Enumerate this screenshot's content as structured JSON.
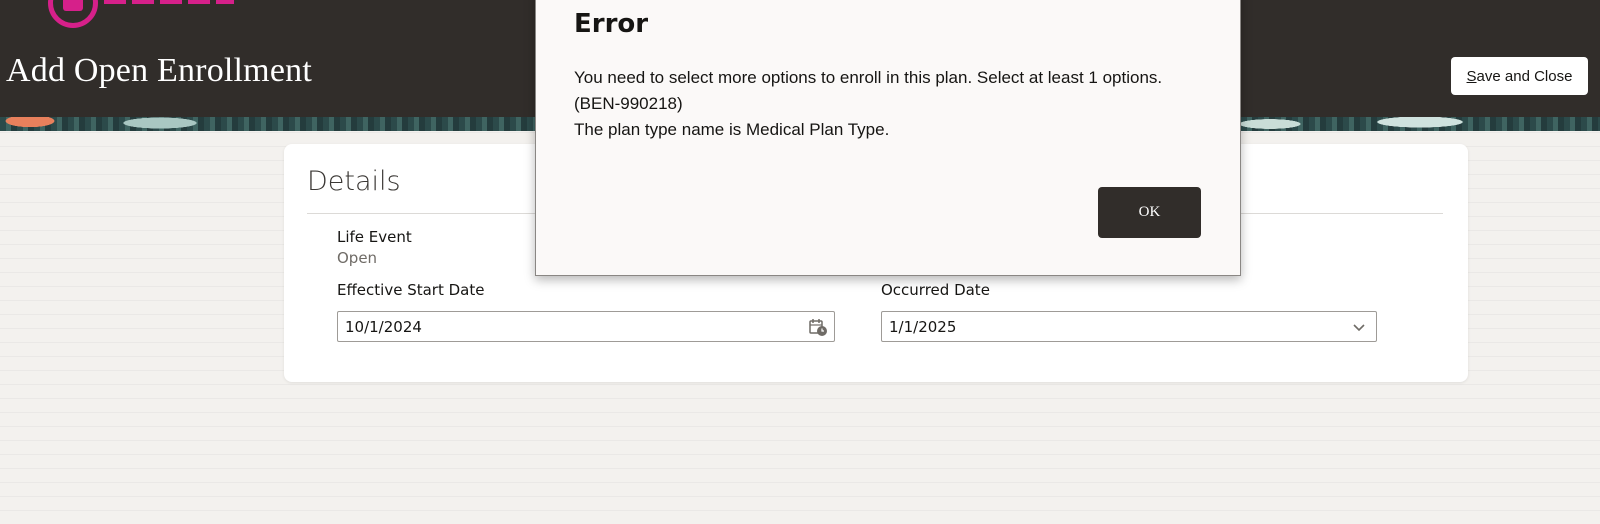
{
  "header": {
    "title": "Add Open Enrollment",
    "save_close_prefix": "S",
    "save_close_rest": "ave and Close",
    "brand_color": "#d6208a",
    "background": "#312d2a"
  },
  "details": {
    "title": "Details",
    "life_event": {
      "label": "Life Event",
      "value": "Open"
    },
    "effective_start_date": {
      "label": "Effective Start Date",
      "value": "10/1/2024",
      "icon": "calendar-icon"
    },
    "occurred_date": {
      "label": "Occurred Date",
      "value": "1/1/2025",
      "icon": "chevron-down-icon"
    }
  },
  "dialog": {
    "title": "Error",
    "message_line_1": "You need to select more options to enroll in this plan. Select at least 1 options. (BEN-990218)",
    "message_line_2": "The plan type name is Medical Plan Type.",
    "ok_label": "OK"
  }
}
